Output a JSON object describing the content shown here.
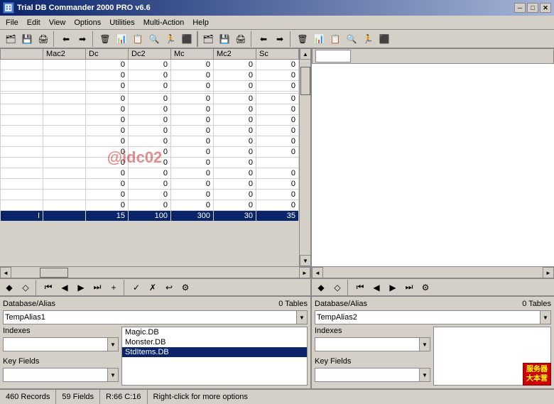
{
  "titleBar": {
    "icon": "🗄",
    "title": "Trial DB Commander 2000 PRO v6.6",
    "minimizeLabel": "─",
    "maximizeLabel": "□",
    "closeLabel": "✕"
  },
  "menuBar": {
    "items": [
      "File",
      "Edit",
      "View",
      "Options",
      "Utilities",
      "Multi-Action",
      "Help"
    ]
  },
  "toolbar": {
    "buttons": [
      "🗂",
      "💾",
      "🖨",
      "←",
      "→",
      "⬛",
      "🗑",
      "📊",
      "📋",
      "🔍",
      "🏃",
      "⬛",
      "←",
      "→",
      "⬛",
      "🗑",
      "📊",
      "📋",
      "🔍",
      "🏃",
      "⬛"
    ]
  },
  "leftPanel": {
    "tableColumns": [
      "Mac2",
      "Dc",
      "Dc2",
      "Mc",
      "Mc2",
      "Sc"
    ],
    "tableData": [
      [
        "",
        "0",
        "0",
        "0",
        "0",
        "0"
      ],
      [
        "",
        "0",
        "0",
        "0",
        "0",
        "0"
      ],
      [
        "",
        "0",
        "0",
        "0",
        "0",
        "0"
      ],
      [
        "",
        "",
        "",
        "",
        "",
        ""
      ],
      [
        "",
        "0",
        "0",
        "0",
        "0",
        "0"
      ],
      [
        "",
        "0",
        "0",
        "0",
        "0",
        "0"
      ],
      [
        "",
        "0",
        "0",
        "0",
        "0",
        "0"
      ],
      [
        "",
        "0",
        "0",
        "0",
        "0",
        "0"
      ],
      [
        "",
        "0",
        "0",
        "0",
        "0",
        "0"
      ],
      [
        "",
        "0",
        "0",
        "0",
        "0",
        "0"
      ],
      [
        "",
        "0",
        "0",
        "0",
        "0",
        ""
      ],
      [
        "",
        "0",
        "0",
        "0",
        "0",
        "0"
      ],
      [
        "",
        "0",
        "0",
        "0",
        "0",
        "0"
      ],
      [
        "",
        "0",
        "0",
        "0",
        "0",
        "0"
      ],
      [
        "",
        "0",
        "0",
        "0",
        "0",
        "0"
      ]
    ],
    "selectedRow": {
      "indicator": "I",
      "values": [
        "15",
        "100",
        "300",
        "30",
        "35"
      ]
    },
    "watermark": "@idc02"
  },
  "rightPanel": {
    "tableColumns": [],
    "inputValue": ""
  },
  "bottomToolbar": {
    "leftButtons": [
      "💎",
      "💎",
      "⏮",
      "◀",
      "▶",
      "⏭",
      "+",
      "✓",
      "✗",
      "↩",
      "⚙"
    ],
    "rightButtons": [
      "💎",
      "💎",
      "⏮",
      "◀",
      "▶",
      "⏭",
      "⚙"
    ]
  },
  "leftDbPanel": {
    "headerLabel": "Database/Alias",
    "tablesLabel": "0 Tables",
    "aliasValue": "TempAlias1",
    "indexesLabel": "Indexes",
    "keyFieldsLabel": "Key Fields",
    "dbList": [
      "Magic.DB",
      "Monster.DB",
      "StdItems.DB"
    ]
  },
  "rightDbPanel": {
    "headerLabel": "Database/Alias",
    "tablesLabel": "0 Tables",
    "aliasValue": "TempAlias2",
    "indexesLabel": "Indexes",
    "keyFieldsLabel": "Key Fields"
  },
  "statusBar": {
    "records": "460 Records",
    "fields": "59 Fields",
    "position": "R:66 C:16",
    "hint": "Right-click for more options"
  },
  "brandBadge": {
    "line1": "服务器",
    "line2": "大本营"
  }
}
